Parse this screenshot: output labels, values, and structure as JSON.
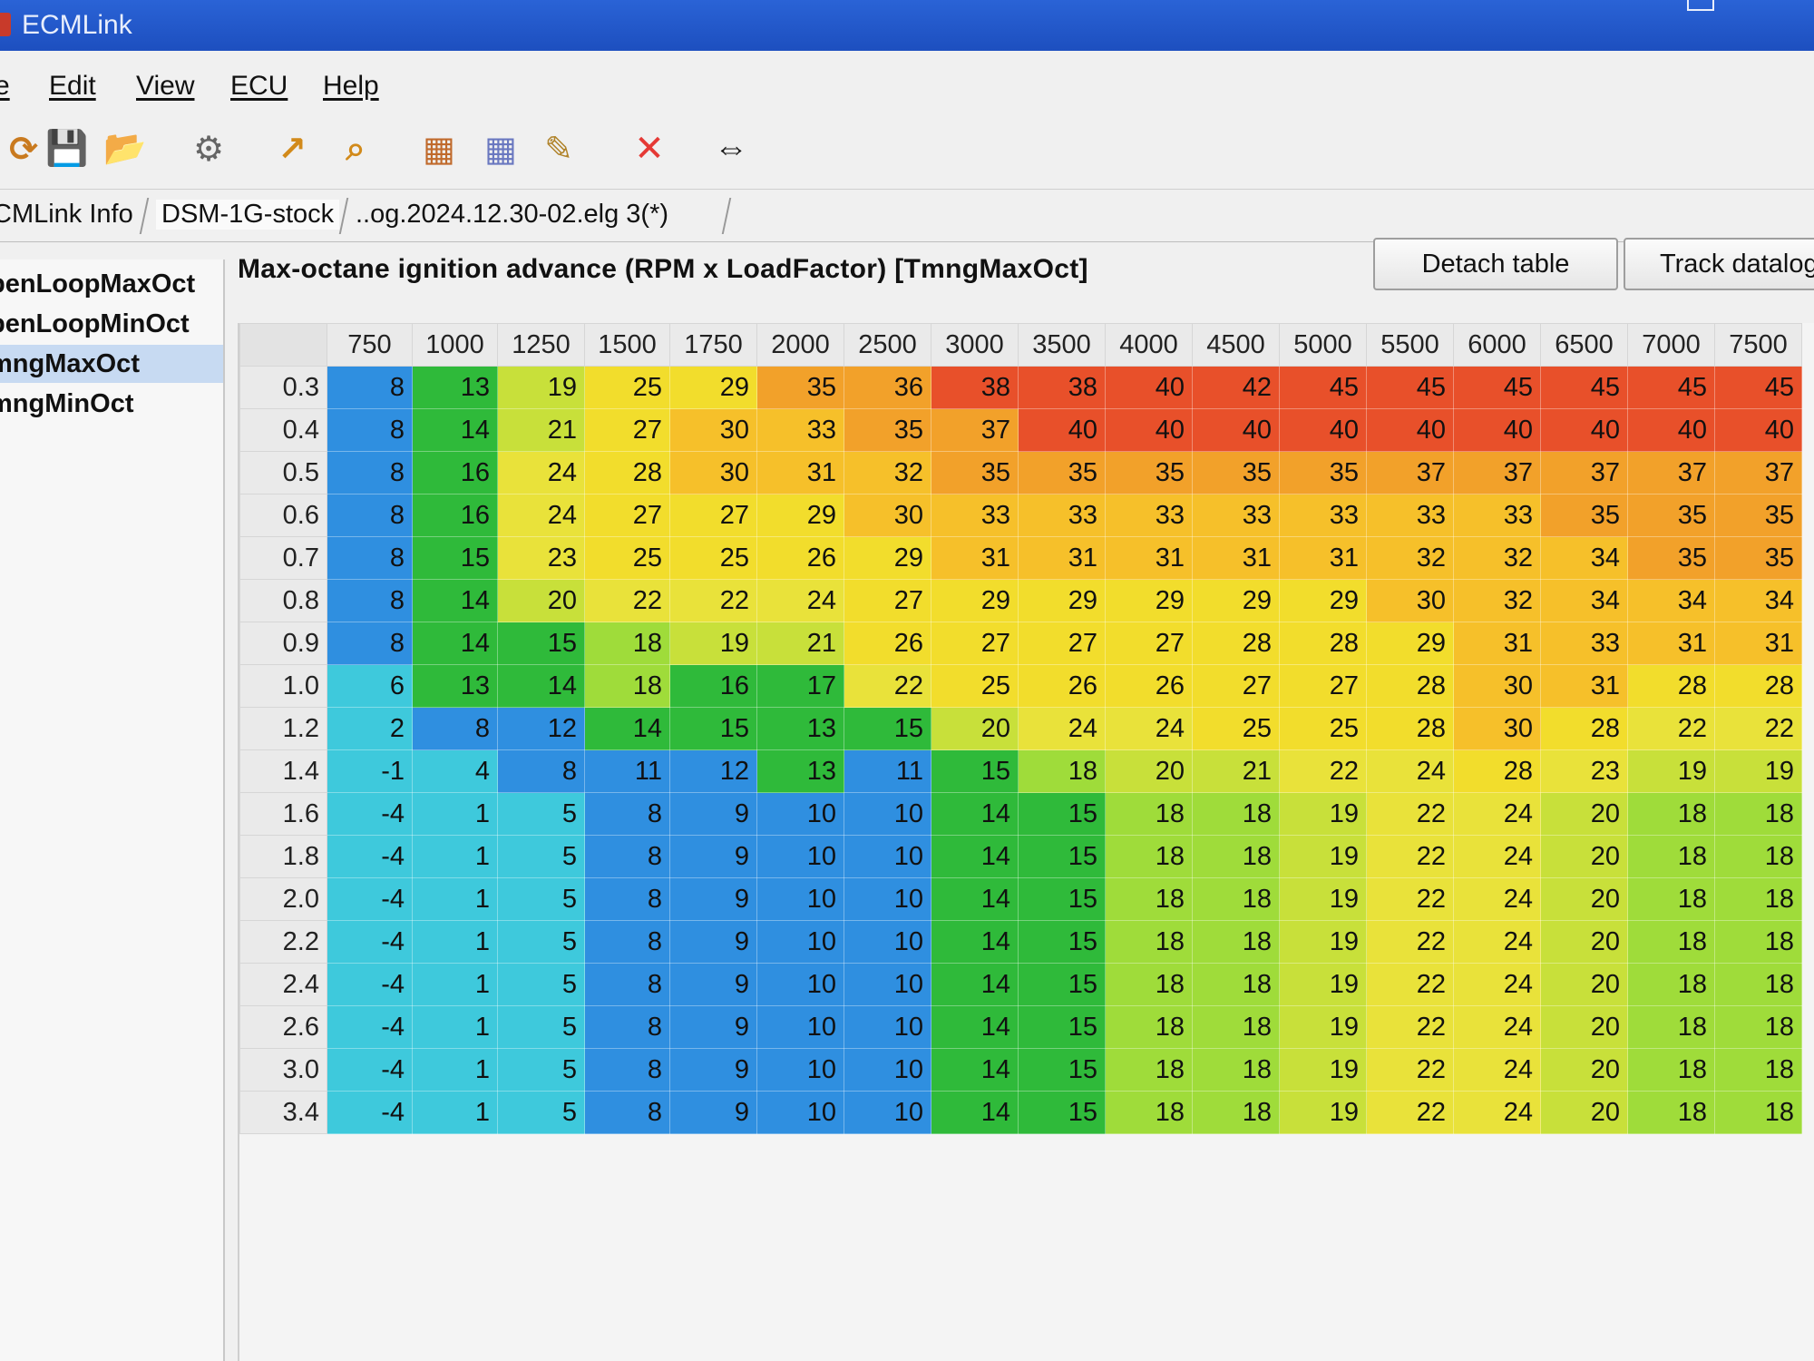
{
  "window": {
    "title": "ECMLink"
  },
  "menu": [
    {
      "name": "file",
      "label": "e"
    },
    {
      "name": "edit",
      "label": "Edit"
    },
    {
      "name": "view",
      "label": "View"
    },
    {
      "name": "ecu",
      "label": "ECU"
    },
    {
      "name": "help",
      "label": "Help"
    }
  ],
  "toolbar": [
    {
      "name": "refresh-icon",
      "glyph": "⟳",
      "color": "#c97a1f"
    },
    {
      "name": "save-icon",
      "glyph": "💾",
      "color": "#a0672a"
    },
    {
      "name": "open-folder-icon",
      "glyph": "📂",
      "color": "#a0672a"
    },
    {
      "name": "wrench-gear-icon",
      "glyph": "⚙",
      "color": "#666666"
    },
    {
      "name": "export-map-icon",
      "glyph": "↗",
      "color": "#d28a1a"
    },
    {
      "name": "search-map-icon",
      "glyph": "⌕",
      "color": "#d28a1a"
    },
    {
      "name": "map-settings-icon",
      "glyph": "▦",
      "color": "#c06a2c"
    },
    {
      "name": "map-compare-icon",
      "glyph": "▦",
      "color": "#6a78c0"
    },
    {
      "name": "tools-icon",
      "glyph": "✎",
      "color": "#b0832a"
    },
    {
      "name": "close-icon",
      "glyph": "✕",
      "color": "#e53935"
    },
    {
      "name": "swap-arrows-icon",
      "glyph": "⇔",
      "color": "#1a1a1a"
    }
  ],
  "tabs": [
    {
      "name": "tab-ecmlink-info",
      "label": "CMLink Info"
    },
    {
      "name": "tab-dsm-1g-stock",
      "label": "DSM-1G-stock"
    },
    {
      "name": "tab-datalog",
      "label": "..og.2024.12.30-02.elg 3(*)"
    }
  ],
  "sidebar": {
    "items": [
      {
        "label": "penLoopMaxOct",
        "selected": false
      },
      {
        "label": "penLoopMinOct",
        "selected": false
      },
      {
        "label": "mngMaxOct",
        "selected": true
      },
      {
        "label": "mngMinOct",
        "selected": false
      }
    ]
  },
  "map": {
    "title": "Max-octane ignition advance (RPM x LoadFactor) [TmngMaxOct]",
    "detach_label": "Detach table",
    "track_label": "Track datalog",
    "rpm": [
      "750",
      "1000",
      "1250",
      "1500",
      "1750",
      "2000",
      "2500",
      "3000",
      "3500",
      "4000",
      "4500",
      "5000",
      "5500",
      "6000",
      "6500",
      "7000",
      "7500"
    ],
    "load": [
      "0.3",
      "0.4",
      "0.5",
      "0.6",
      "0.7",
      "0.8",
      "0.9",
      "1.0",
      "1.2",
      "1.4",
      "1.6",
      "1.8",
      "2.0",
      "2.2",
      "2.4",
      "2.6",
      "3.0",
      "3.4"
    ],
    "values": [
      [
        8,
        13,
        19,
        25,
        29,
        35,
        36,
        38,
        38,
        40,
        42,
        45,
        45,
        45,
        45,
        45,
        45
      ],
      [
        8,
        14,
        21,
        27,
        30,
        33,
        35,
        37,
        40,
        40,
        40,
        40,
        40,
        40,
        40,
        40,
        40
      ],
      [
        8,
        16,
        24,
        28,
        30,
        31,
        32,
        35,
        35,
        35,
        35,
        35,
        37,
        37,
        37,
        37,
        37
      ],
      [
        8,
        16,
        24,
        27,
        27,
        29,
        30,
        33,
        33,
        33,
        33,
        33,
        33,
        33,
        35,
        35,
        35
      ],
      [
        8,
        15,
        23,
        25,
        25,
        26,
        29,
        31,
        31,
        31,
        31,
        31,
        32,
        32,
        34,
        35,
        35
      ],
      [
        8,
        14,
        20,
        22,
        22,
        24,
        27,
        29,
        29,
        29,
        29,
        29,
        30,
        32,
        34,
        34,
        34
      ],
      [
        8,
        14,
        15,
        18,
        19,
        21,
        26,
        27,
        27,
        27,
        28,
        28,
        29,
        31,
        33,
        31,
        31
      ],
      [
        6,
        13,
        14,
        18,
        16,
        17,
        22,
        25,
        26,
        26,
        27,
        27,
        28,
        30,
        31,
        28,
        28
      ],
      [
        2,
        8,
        12,
        14,
        15,
        13,
        15,
        20,
        24,
        24,
        25,
        25,
        28,
        30,
        28,
        22,
        22
      ],
      [
        -1,
        4,
        8,
        11,
        12,
        13,
        11,
        15,
        18,
        20,
        21,
        22,
        24,
        28,
        23,
        19,
        19
      ],
      [
        -4,
        1,
        5,
        8,
        9,
        10,
        10,
        14,
        15,
        18,
        18,
        19,
        22,
        24,
        20,
        18,
        18
      ],
      [
        -4,
        1,
        5,
        8,
        9,
        10,
        10,
        14,
        15,
        18,
        18,
        19,
        22,
        24,
        20,
        18,
        18
      ],
      [
        -4,
        1,
        5,
        8,
        9,
        10,
        10,
        14,
        15,
        18,
        18,
        19,
        22,
        24,
        20,
        18,
        18
      ],
      [
        -4,
        1,
        5,
        8,
        9,
        10,
        10,
        14,
        15,
        18,
        18,
        19,
        22,
        24,
        20,
        18,
        18
      ],
      [
        -4,
        1,
        5,
        8,
        9,
        10,
        10,
        14,
        15,
        18,
        18,
        19,
        22,
        24,
        20,
        18,
        18
      ],
      [
        -4,
        1,
        5,
        8,
        9,
        10,
        10,
        14,
        15,
        18,
        18,
        19,
        22,
        24,
        20,
        18,
        18
      ],
      [
        -4,
        1,
        5,
        8,
        9,
        10,
        10,
        14,
        15,
        18,
        18,
        19,
        22,
        24,
        20,
        18,
        18
      ],
      [
        -4,
        1,
        5,
        8,
        9,
        10,
        10,
        14,
        15,
        18,
        18,
        19,
        22,
        24,
        20,
        18,
        18
      ]
    ],
    "colors": {
      "cyan": "#3ec9dc",
      "blue": "#2f8fe0",
      "green": "#2fba3a",
      "lightgreen": "#9fdc3a",
      "yellow": "#f2dd2c",
      "orange": "#f2a12a",
      "red": "#e8502a"
    }
  }
}
